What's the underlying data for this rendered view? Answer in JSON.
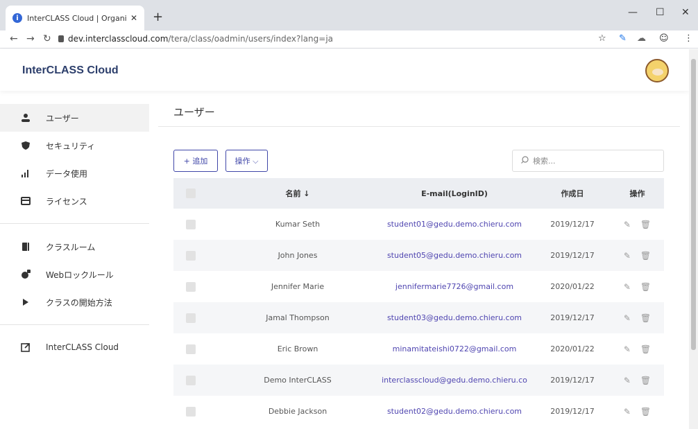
{
  "browser": {
    "tab_title": "InterCLASS Cloud | Organization",
    "url_host": "dev.interclasscloud.com",
    "url_path": "/tera/class/oadmin/users/index?lang=ja"
  },
  "header": {
    "brand": "InterCLASS Cloud"
  },
  "sidebar": {
    "items": [
      {
        "label": "ユーザー",
        "icon": "user-icon"
      },
      {
        "label": "セキュリティ",
        "icon": "shield-icon"
      },
      {
        "label": "データ使用",
        "icon": "bar-chart-icon"
      },
      {
        "label": "ライセンス",
        "icon": "card-icon"
      },
      {
        "label": "クラスルーム",
        "icon": "book-icon"
      },
      {
        "label": "Webロックルール",
        "icon": "globe-lock-icon"
      },
      {
        "label": "クラスの開始方法",
        "icon": "play-icon"
      },
      {
        "label": "InterCLASS Cloud",
        "icon": "external-link-icon"
      }
    ]
  },
  "main": {
    "title": "ユーザー",
    "add_label": "+ 追加",
    "ops_label": "操作 ⌵",
    "search_placeholder": "検索...",
    "columns": {
      "name": "名前 ↓",
      "email": "E-mail(LoginID)",
      "date": "作成日",
      "ops": "操作"
    },
    "rows": [
      {
        "name": "Kumar Seth",
        "email": "student01@gedu.demo.chieru.com",
        "date": "2019/12/17"
      },
      {
        "name": "John Jones",
        "email": "student05@gedu.demo.chieru.com",
        "date": "2019/12/17"
      },
      {
        "name": "Jennifer Marie",
        "email": "jennifermarie7726@gmail.com",
        "date": "2020/01/22"
      },
      {
        "name": "Jamal Thompson",
        "email": "student03@gedu.demo.chieru.com",
        "date": "2019/12/17"
      },
      {
        "name": "Eric Brown",
        "email": "minamitateishi0722@gmail.com",
        "date": "2020/01/22"
      },
      {
        "name": "Demo InterCLASS",
        "email": "interclasscloud@gedu.demo.chieru.co",
        "date": "2019/12/17"
      },
      {
        "name": "Debbie Jackson",
        "email": "student02@gedu.demo.chieru.com",
        "date": "2019/12/17"
      }
    ]
  },
  "colors": {
    "accent": "#3f46a8",
    "email": "#4f45b0",
    "brand": "#2c3e6b"
  }
}
